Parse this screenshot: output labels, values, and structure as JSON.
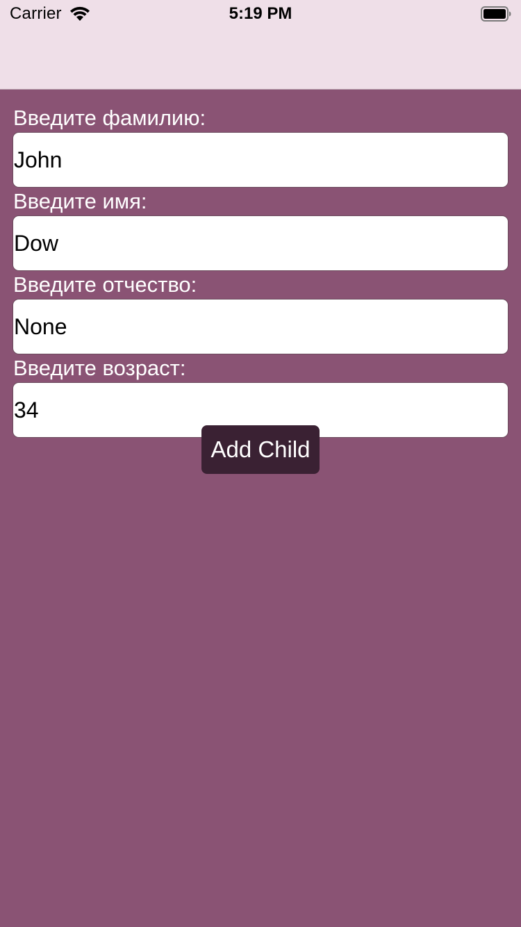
{
  "status_bar": {
    "carrier": "Carrier",
    "time": "5:19 PM",
    "wifi_icon": "wifi-icon",
    "battery_icon": "battery-full-icon"
  },
  "nav_bar": {
    "title": ""
  },
  "form": {
    "last_name": {
      "label": "Введите фамилию:",
      "value": "John"
    },
    "first_name": {
      "label": "Введите имя:",
      "value": "Dow"
    },
    "patronymic": {
      "label": "Введите отчество:",
      "value": "None"
    },
    "age": {
      "label": "Введите возраст:",
      "value": "34"
    }
  },
  "actions": {
    "add_child_label": "Add Child"
  },
  "colors": {
    "background": "#8a5374",
    "bar_background": "#efdfe8",
    "button_background": "#3a2133",
    "button_text": "#ffffff",
    "label_text": "#ffffff"
  }
}
